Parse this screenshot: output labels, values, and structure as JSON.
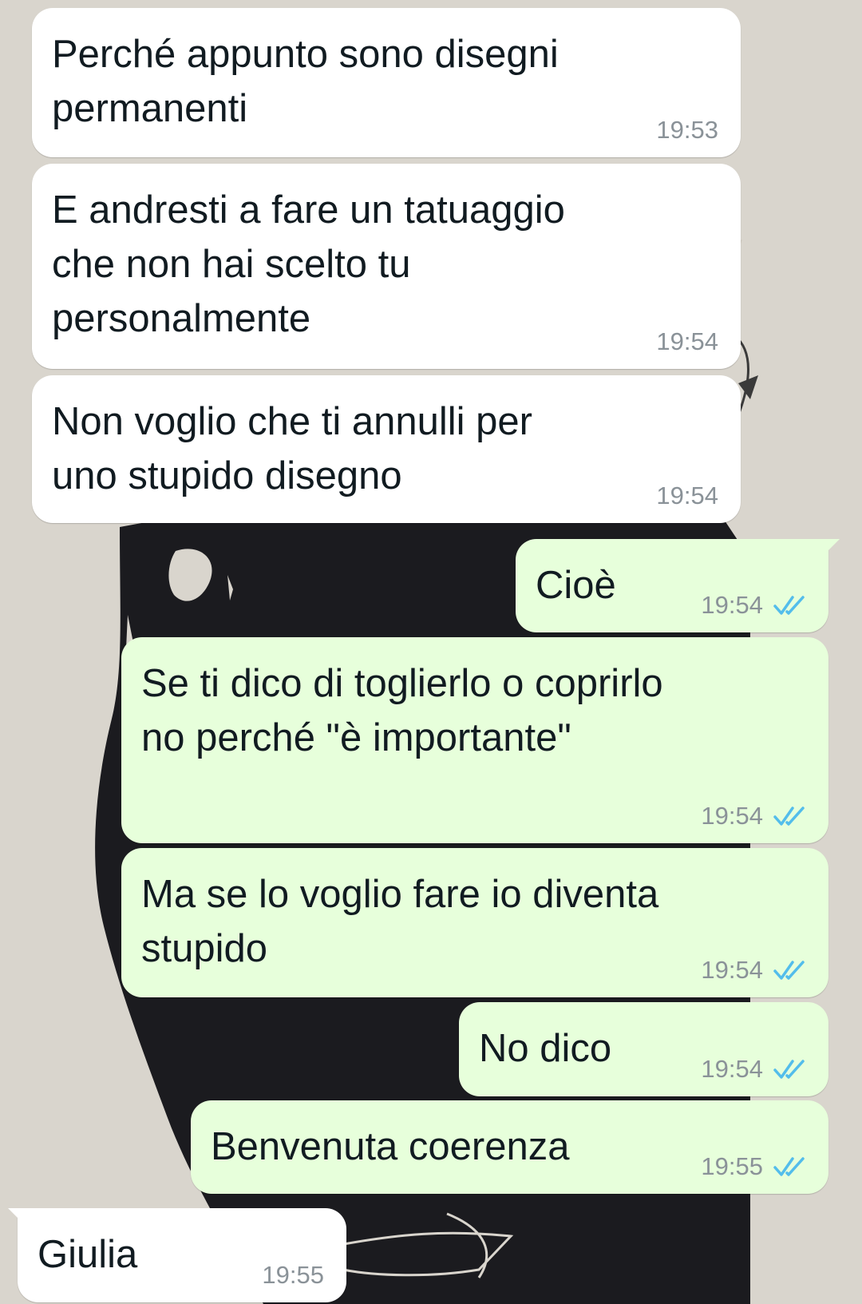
{
  "chat": {
    "theme": {
      "incoming_bg": "#ffffff",
      "outgoing_bg": "#e7ffdb",
      "text_color": "#111b21",
      "time_color": "#8a9298",
      "read_tick_color": "#53bdeb"
    },
    "messages": [
      {
        "direction": "in",
        "text": "Perché appunto sono disegni\npermanenti",
        "time": "19:53"
      },
      {
        "direction": "in",
        "text": "E andresti a fare un tatuaggio\nche non hai scelto tu\npersonalmente",
        "time": "19:54"
      },
      {
        "direction": "in",
        "text": "Non voglio che ti annulli per\nuno stupido disegno",
        "time": "19:54"
      },
      {
        "direction": "out",
        "text": "Cioè",
        "time": "19:54",
        "status_icon": "read-ticks-icon"
      },
      {
        "direction": "out",
        "text": "Se ti dico di toglierlo o coprirlo\nno perché \"è importante\"",
        "time": "19:54",
        "status_icon": "read-ticks-icon"
      },
      {
        "direction": "out",
        "text": "Ma se lo voglio fare io diventa\nstupido",
        "time": "19:54",
        "status_icon": "read-ticks-icon"
      },
      {
        "direction": "out",
        "text": "No dico",
        "time": "19:54",
        "status_icon": "read-ticks-icon"
      },
      {
        "direction": "out",
        "text": "Benvenuta coerenza",
        "time": "19:55",
        "status_icon": "read-ticks-icon"
      },
      {
        "direction": "in",
        "text": "Giulia",
        "time": "19:55"
      }
    ]
  }
}
